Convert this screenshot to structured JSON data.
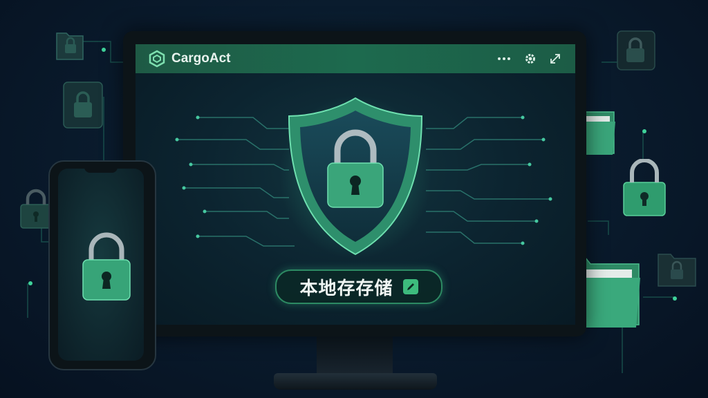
{
  "app": {
    "title": "CargoAct",
    "logo_icon": "cargoact-logo-icon"
  },
  "toolbar": {
    "more_icon": "more-dots-icon",
    "settings_icon": "gear-icon",
    "expand_icon": "expand-arrows-icon"
  },
  "main": {
    "storage_label": "本地存存储",
    "edit_icon": "edit-pencil-icon",
    "hero_icon": "shield-lock-icon"
  },
  "colors": {
    "accent": "#2fae74",
    "titlebar": "#1d6a4e",
    "background": "#081526"
  }
}
